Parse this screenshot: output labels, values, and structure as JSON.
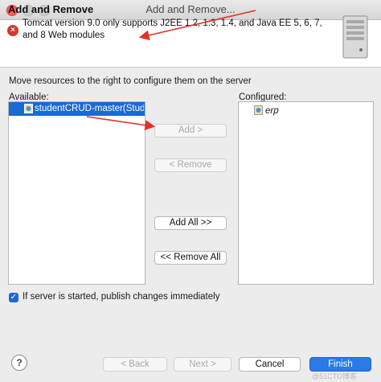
{
  "window": {
    "title": "Add and Remove..."
  },
  "header": {
    "title": "Add and Remove",
    "error_message": "Tomcat version 9.0 only supports J2EE 1.2, 1.3, 1.4, and Java EE 5, 6, 7, and 8 Web modules",
    "icons": {
      "error": "error-icon",
      "server": "server-icon"
    }
  },
  "main": {
    "instruction": "Move resources to the right to configure them on the server",
    "available_label": "Available:",
    "configured_label": "Configured:",
    "available_items": [
      {
        "label": "studentCRUD-master(Stude",
        "selected": true
      }
    ],
    "configured_items": [
      {
        "label": "erp"
      }
    ],
    "buttons": {
      "add": "Add >",
      "remove": "< Remove",
      "add_all": "Add All >>",
      "remove_all": "<< Remove All"
    },
    "publish_checkbox": {
      "label": "If server is started, publish changes immediately",
      "checked": true
    }
  },
  "footer": {
    "help": "?",
    "back": "< Back",
    "next": "Next >",
    "cancel": "Cancel",
    "finish": "Finish",
    "watermark": "@51CTO博客"
  },
  "colors": {
    "accent": "#2a7ae8",
    "selection": "#1a69d4",
    "error": "#d4392d",
    "annotation_arrow": "#e0322a"
  }
}
